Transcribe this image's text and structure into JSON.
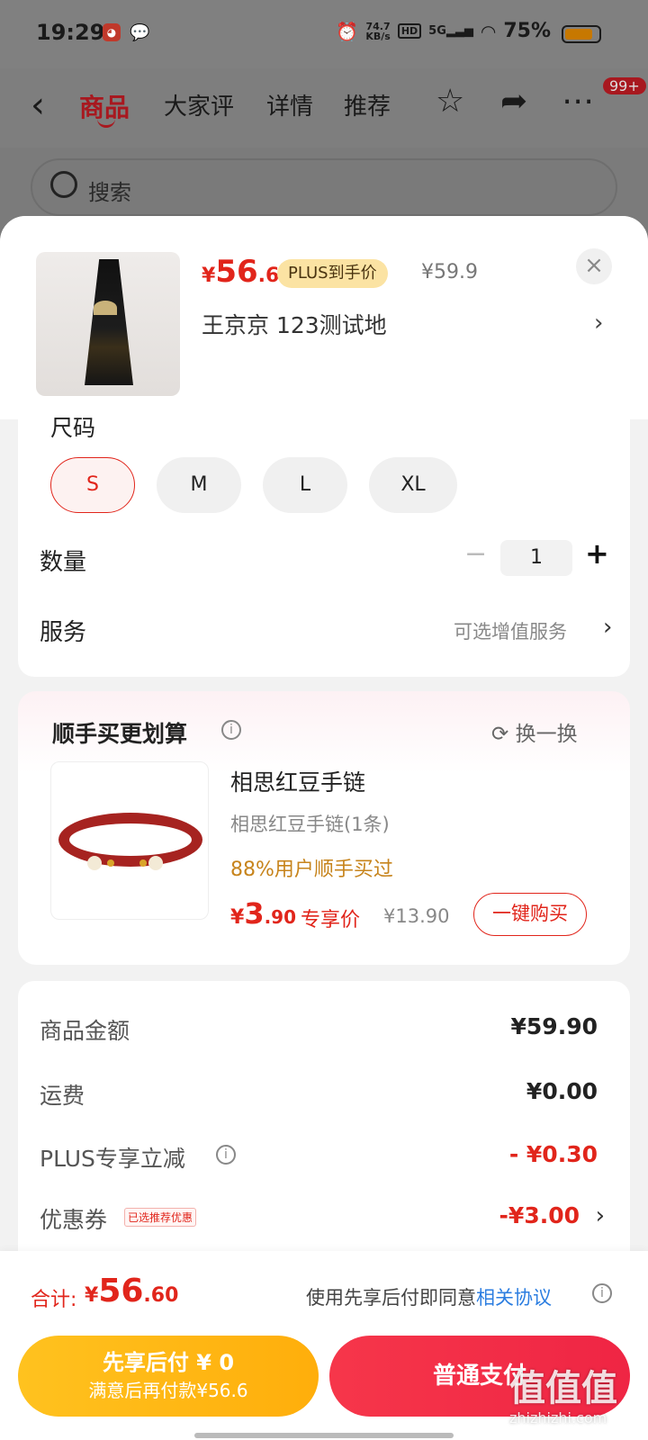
{
  "status_bar": {
    "time": "19:29",
    "net_speed_value": "74.7",
    "net_speed_unit": "KB/s",
    "hd": "HD",
    "signal": "5G",
    "battery": "75%"
  },
  "nav": {
    "tabs": [
      "商品",
      "大家评",
      "详情",
      "推荐"
    ],
    "active_tab": "商品",
    "cart_badge": "99+"
  },
  "search": {
    "placeholder": "搜索"
  },
  "sku": {
    "price_currency": "¥",
    "price_int": "56",
    "price_dec": ".6",
    "plus_tag": "PLUS到手价",
    "original_price": "¥59.9",
    "address": "王京京  123测试地"
  },
  "options": {
    "size_title": "尺码",
    "sizes": [
      "S",
      "M",
      "L",
      "XL"
    ],
    "selected_size": "S",
    "quantity_label": "数量",
    "quantity": "1",
    "service_label": "服务",
    "service_hint": "可选增值服务"
  },
  "addon": {
    "title": "顺手买更划算",
    "swap_label": "换一换",
    "product_name": "相思红豆手链",
    "product_sub": "相思红豆手链(1条)",
    "promo": "88%用户顺手买过",
    "price_currency": "¥",
    "price_int": "3",
    "price_dec": ".90",
    "exclusive_label": "专享价",
    "original_price": "¥13.90",
    "buy_label": "一键购买"
  },
  "fees": [
    {
      "label": "商品金额",
      "value": "¥59.90",
      "highlight": false
    },
    {
      "label": "运费",
      "value": "¥0.00",
      "highlight": false
    },
    {
      "label": "PLUS专享立减",
      "value": "- ¥0.30",
      "highlight": true
    },
    {
      "label": "优惠券",
      "value": "-¥3.00",
      "highlight": true,
      "tag": "已选推荐优惠"
    }
  ],
  "bottom": {
    "total_label": "合计:",
    "total_currency": "¥",
    "total_int": "56",
    "total_dec": ".60",
    "agreement_text": "使用先享后付即同意",
    "agreement_link": "相关协议",
    "pay_later_line1": "先享后付 ¥ 0",
    "pay_later_line2": "满意后再付款¥56.6",
    "pay_label": "普通支付"
  },
  "watermark": {
    "text": "值值值",
    "url": "zhizhizhi.com"
  },
  "colors": {
    "accent": "#e1251b",
    "pay_later": "#ffb814",
    "pay": "#f2304a",
    "link": "#2b7de0"
  }
}
